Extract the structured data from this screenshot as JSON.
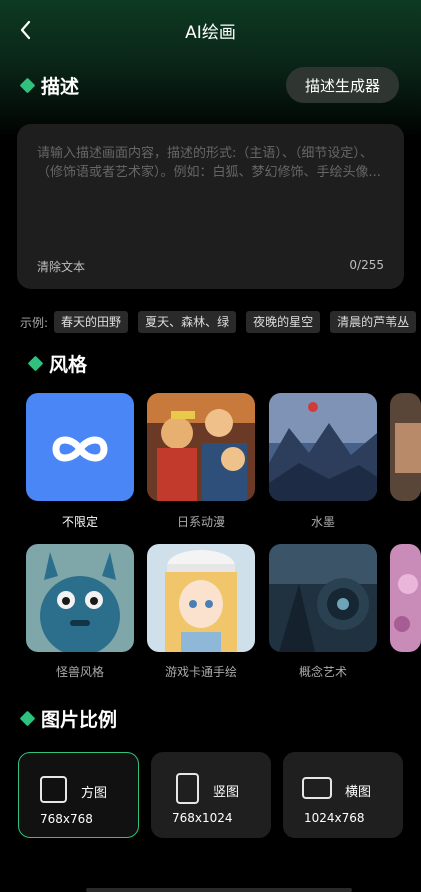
{
  "header": {
    "title": "AI绘画"
  },
  "describe": {
    "section_title": "描述",
    "generator_button": "描述生成器",
    "placeholder": "请输入描述画面内容，描述的形式:（主语）、（细节设定）、（修饰语或者艺术家）。例如：白狐、梦幻修饰、手绘头像...",
    "clear_label": "清除文本",
    "char_count": "0/255"
  },
  "examples": {
    "label": "示例:",
    "chips": [
      "春天的田野",
      "夏天、森林、绿",
      "夜晚的星空",
      "清晨的芦苇丛"
    ]
  },
  "style": {
    "section_title": "风格",
    "items": [
      {
        "label": "不限定",
        "icon": "infinity-icon",
        "selected": true
      },
      {
        "label": "日系动漫"
      },
      {
        "label": "水墨"
      },
      {
        "label": ""
      },
      {
        "label": "怪兽风格"
      },
      {
        "label": "游戏卡通手绘"
      },
      {
        "label": "概念艺术"
      },
      {
        "label": ""
      }
    ]
  },
  "ratio": {
    "section_title": "图片比例",
    "items": [
      {
        "name": "方图",
        "size": "768x768",
        "selected": true
      },
      {
        "name": "竖图",
        "size": "768x1024"
      },
      {
        "name": "横图",
        "size": "1024x768"
      }
    ]
  },
  "colors": {
    "accent": "#2ec27e",
    "background": "#000000",
    "card": "#1e1e1e",
    "selected_style": "#4a86f5"
  }
}
